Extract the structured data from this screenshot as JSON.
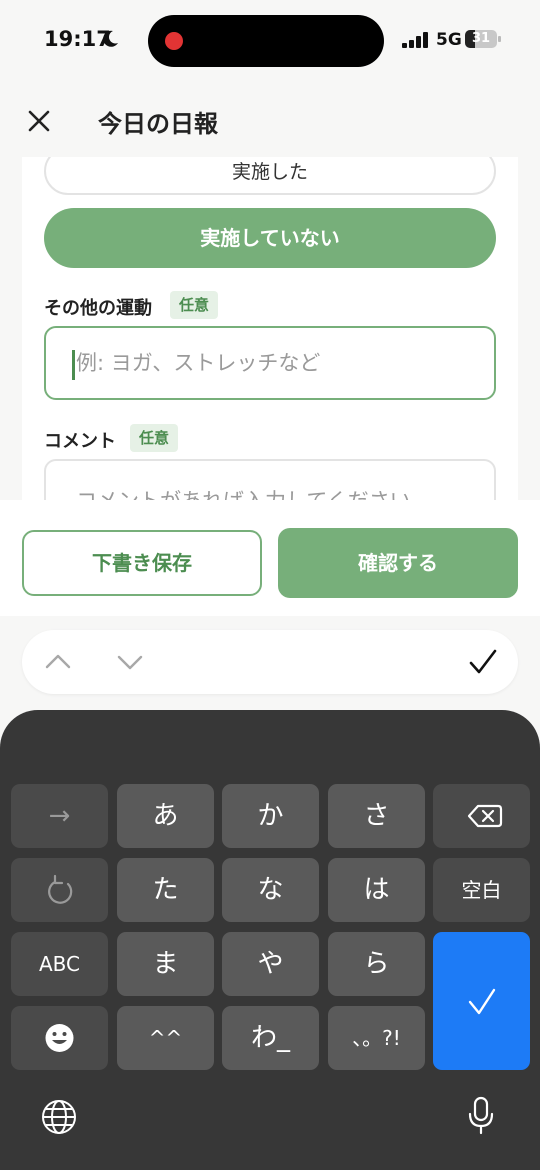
{
  "status_bar": {
    "time": "19:17",
    "network": "5G",
    "battery": "31",
    "battery_level": 0.31
  },
  "header": {
    "title": "今日の日報",
    "close_icon": "close-icon"
  },
  "form": {
    "option_done": "実施した",
    "option_not_done": "実施していない",
    "other_exercise_label": "その他の運動",
    "other_exercise_badge": "任意",
    "other_exercise_placeholder": "例: ヨガ、ストレッチなど",
    "comment_label": "コメント",
    "comment_badge": "任意",
    "comment_placeholder": "コメントがあれば入力してください"
  },
  "actions": {
    "draft_label": "下書き保存",
    "confirm_label": "確認する"
  },
  "colors": {
    "accent": "#77af7a",
    "accent_dark": "#4c8d50",
    "badge_bg": "#e6f1e6",
    "keyboard_bg": "#373737",
    "key_bg": "#5a5a5a",
    "return_key": "#1d7bf6"
  },
  "keyboard": {
    "row1": [
      "→",
      "あ",
      "か",
      "さ"
    ],
    "row2": [
      "た",
      "な",
      "は",
      "空白"
    ],
    "row3": [
      "ABC",
      "ま",
      "や",
      "ら"
    ],
    "row4": [
      "^^",
      "わ_",
      "、。?!"
    ],
    "icons": [
      "delete-icon",
      "undo-icon",
      "emoji-icon",
      "return-check-icon",
      "globe-icon",
      "mic-icon"
    ]
  }
}
